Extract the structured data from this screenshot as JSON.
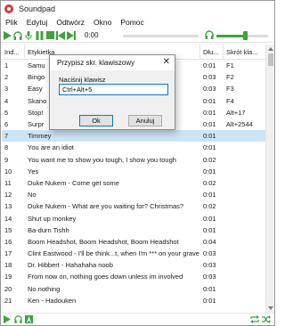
{
  "window": {
    "title": "Soundpad"
  },
  "menu": [
    "Plik",
    "Edytuj",
    "Odtwórz",
    "Okno",
    "Pomoc"
  ],
  "player": {
    "time": "0:00",
    "volume_level": 0.55
  },
  "columns": {
    "index": "Ind...",
    "label": "Etykietka",
    "duration": "Dłu...",
    "hotkey": "Skrót kla..."
  },
  "rows": [
    {
      "index": "1",
      "label": "Samu",
      "duration": "0:01",
      "hotkey": "F1"
    },
    {
      "index": "2",
      "label": "Bingo",
      "duration": "0:03",
      "hotkey": "F2"
    },
    {
      "index": "3",
      "label": "Easy",
      "duration": "0:03",
      "hotkey": "F3"
    },
    {
      "index": "4",
      "label": "Skano",
      "duration": "0:01",
      "hotkey": "F4"
    },
    {
      "index": "5",
      "label": "Stop!",
      "duration": "0:01",
      "hotkey": "Alt+17"
    },
    {
      "index": "6",
      "label": "Surpr",
      "duration": "0:01",
      "hotkey": "Alt+2544"
    },
    {
      "index": "7",
      "label": "Timmey",
      "duration": "0:01",
      "hotkey": "",
      "selected": true
    },
    {
      "index": "8",
      "label": "You are an idiot",
      "duration": "0:01",
      "hotkey": ""
    },
    {
      "index": "9",
      "label": "You want me to show you tough, I show you tough",
      "duration": "0:02",
      "hotkey": ""
    },
    {
      "index": "10",
      "label": "Yes",
      "duration": "0:01",
      "hotkey": ""
    },
    {
      "index": "11",
      "label": "Duke Nukem - Come get some",
      "duration": "0:02",
      "hotkey": ""
    },
    {
      "index": "12",
      "label": "No",
      "duration": "0:01",
      "hotkey": ""
    },
    {
      "index": "13",
      "label": "Duke Nukem - What are you waiting for? Christmas?",
      "duration": "0:02",
      "hotkey": ""
    },
    {
      "index": "14",
      "label": "Shut up monkey",
      "duration": "0:01",
      "hotkey": ""
    },
    {
      "index": "15",
      "label": "Ba-durn Tishh",
      "duration": "0:01",
      "hotkey": ""
    },
    {
      "index": "16",
      "label": "Boom Headshot, Boom Headshot, Boom Headshot",
      "duration": "0:04",
      "hotkey": ""
    },
    {
      "index": "17",
      "label": "Clint Eastwood - I'll be think...t, when I'm *** on your grave",
      "duration": "0:03",
      "hotkey": ""
    },
    {
      "index": "18",
      "label": "Dr. Hibbert - Hahahaha noob",
      "duration": "0:03",
      "hotkey": ""
    },
    {
      "index": "19",
      "label": "From now on, nothing goes down unless im involved",
      "duration": "0:03",
      "hotkey": ""
    },
    {
      "index": "20",
      "label": "No nothing",
      "duration": "0:01",
      "hotkey": ""
    },
    {
      "index": "21",
      "label": "Ken - Hadouken",
      "duration": "0:01",
      "hotkey": ""
    }
  ],
  "dialog": {
    "title": "Przypisz skr. klawiszowy",
    "close": "✕",
    "field_label": "Naciśnij klawisz",
    "field_value": "Ctrl+Alt+5",
    "ok_label": "Ok",
    "cancel_label": "Anuluj"
  },
  "icons": {
    "play": "play-icon",
    "headphones": "headphones-icon",
    "mic": "mic-icon",
    "pause": "pause-icon",
    "stop": "stop-icon",
    "prev": "previous-icon",
    "next": "next-icon",
    "volume": "headphones-icon",
    "repeat": "repeat-icon",
    "shuffle": "shuffle-icon"
  },
  "colors": {
    "accent_green": "#3ca33c",
    "selection": "#cce4f7",
    "dialog_bg": "#f0f0f0"
  }
}
